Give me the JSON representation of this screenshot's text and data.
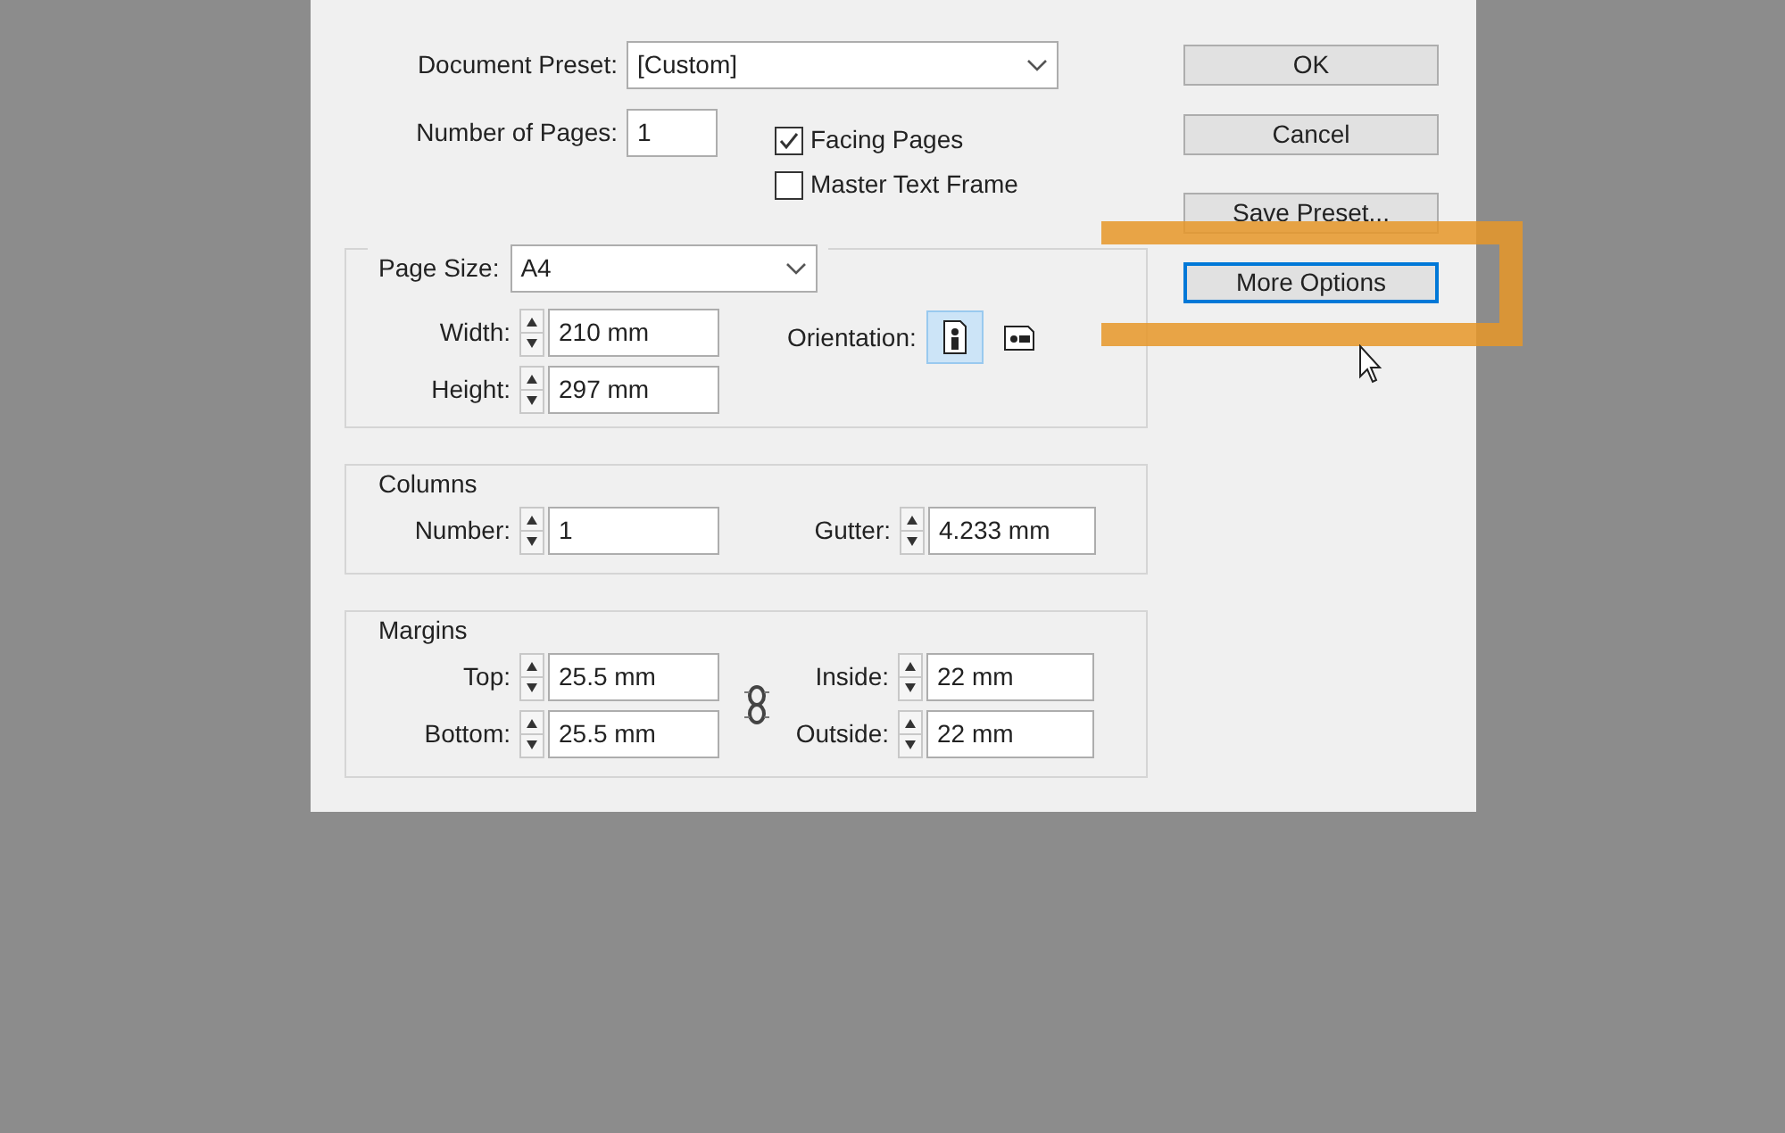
{
  "dialog": {
    "document_preset": {
      "label": "Document Preset:",
      "value": "[Custom]"
    },
    "number_of_pages": {
      "label": "Number of Pages:",
      "value": "1"
    },
    "checkboxes": [
      {
        "label": "Facing Pages",
        "checked": true
      },
      {
        "label": "Master Text Frame",
        "checked": false
      }
    ],
    "page_size": {
      "label": "Page Size:",
      "value": "A4",
      "fields": [
        {
          "label": "Width:",
          "value": "210 mm"
        },
        {
          "label": "Height:",
          "value": "297 mm"
        }
      ],
      "orientation": {
        "label": "Orientation:",
        "options": [
          {
            "kind": "portrait",
            "selected": true
          },
          {
            "kind": "landscape",
            "selected": false
          }
        ]
      }
    },
    "columns": {
      "title": "Columns",
      "fields": [
        {
          "label": "Number:",
          "value": "1"
        },
        {
          "label": "Gutter:",
          "value": "4.233 mm"
        }
      ]
    },
    "margins": {
      "title": "Margins",
      "fields": [
        {
          "label": "Top:",
          "value": "25.5 mm"
        },
        {
          "label": "Inside:",
          "value": "22 mm"
        },
        {
          "label": "Bottom:",
          "value": "25.5 mm"
        },
        {
          "label": "Outside:",
          "value": "22 mm"
        }
      ]
    },
    "buttons": [
      {
        "label": "OK",
        "focused": false
      },
      {
        "label": "Cancel",
        "focused": false
      },
      {
        "label": "Save Preset...",
        "focused": false
      },
      {
        "label": "More Options",
        "focused": true
      }
    ]
  }
}
